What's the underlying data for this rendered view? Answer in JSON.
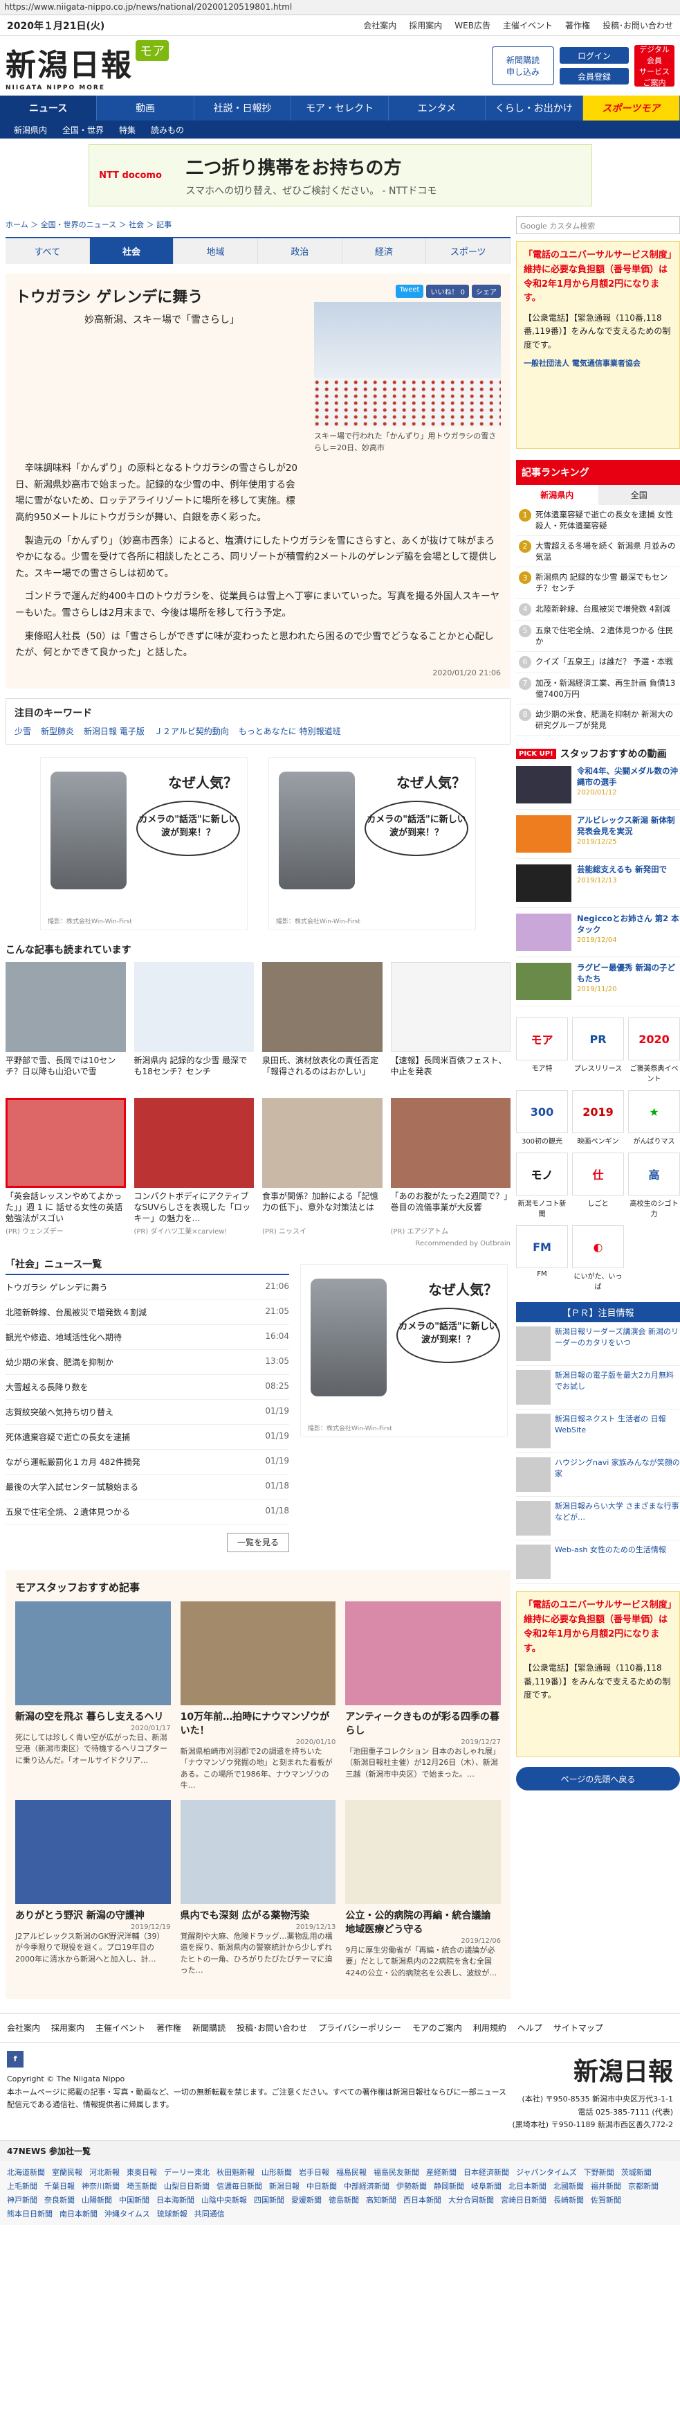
{
  "browser": {
    "url": "https://www.niigata-nippo.co.jp/news/national/20200120519801.html"
  },
  "topbar": {
    "date": "2020年１月21日(火)",
    "links": [
      "会社案内",
      "採用案内",
      "WEB広告",
      "主催イベント",
      "著作権",
      "投稿･お問い合わせ"
    ]
  },
  "header": {
    "logo": "新潟日報",
    "logo_sub": "NIIGATA NIPPO MORE",
    "logo_moa": "モア",
    "register": "新聞購読\n申し込み",
    "login": "ログイン",
    "member": "会員登録",
    "digital": "デジタル\n会員\nサービス\nご案内"
  },
  "gnav": [
    "ニュース",
    "動画",
    "社説・日報抄",
    "モア・セレクト",
    "エンタメ",
    "くらし・お出かけ",
    "スポーツモア"
  ],
  "subnav": [
    "新潟県内",
    "全国・世界",
    "特集",
    "読みもの"
  ],
  "banner": {
    "title": "二つ折り携帯をお持ちの方",
    "text": "スマホへの切り替え、ぜひご検討ください。 - NTTドコモ",
    "brand": "NTT docomo"
  },
  "breadcrumb": "ホーム ＞ 全国・世界のニュース ＞ 社会 ＞ 記事",
  "tabs": [
    "すべて",
    "社会",
    "地域",
    "政治",
    "経済",
    "スポーツ"
  ],
  "article": {
    "title": "トウガラシ ゲレンデに舞う",
    "subtitle": "妙高新潟、スキー場で「雪さらし」",
    "share": [
      "Tweet",
      "いいね！ 0",
      "シェア"
    ],
    "caption": "スキー場で行われた「かんずり」用トウガラシの雪さらし＝20日、妙高市",
    "paragraphs": [
      "辛味調味料「かんずり」の原料となるトウガラシの雪さらしが20日、新潟県妙高市で始まった。記録的な少雪の中、例年使用する会場に雪がないため、ロッテアライリゾートに場所を移して実施。標高約950メートルにトウガラシが舞い、白銀を赤く彩った。",
      "製造元の「かんずり」（妙高市西条）によると、塩漬けにしたトウガラシを雪にさらすと、あくが抜けて味がまろやかになる。少雪を受けて各所に相談したところ、同リゾートが積雪約2メートルのゲレンデ脇を会場として提供した。スキー場での雪さらしは初めて。",
      "ゴンドラで運んだ約400キロのトウガラシを、従業員らは雪上へ丁寧にまいていった。写真を撮る外国人スキーヤーもいた。雪さらしは2月末まで、今後は場所を移して行う予定。",
      "東條昭人社長（50）は「雪さらしができずに味が変わったと思われたら困るので少雪でどうなることかと心配したが、何とかできて良かった」と話した。"
    ],
    "date": "2020/01/20 21:06"
  },
  "keywords": {
    "title": "注目のキーワード",
    "items": [
      "少雪",
      "新型肺炎",
      "新潟日報 電子版",
      "Ｊ２アルビ契約動向",
      "もっとあなたに 特別報道班"
    ]
  },
  "ad_box": {
    "q": "なぜ人気？",
    "bubble": "カメラの\"話活\"に新しい波が到来！？",
    "note": "撮影：株式会社Win-Win-First"
  },
  "recommend": {
    "title": "こんな記事も読まれています",
    "items": [
      {
        "t": "平野部で雪、長岡では10センチ？日以降も山沿いで雪",
        "pr": ""
      },
      {
        "t": "新潟県内 記録的な少雪 最深でも18センチ？センチ",
        "pr": ""
      },
      {
        "t": "泉田氏、演材放表化の責任否定「報得されるのはおかしい」",
        "pr": ""
      },
      {
        "t": "【速報】長岡米百俵フェスト、中止を発表",
        "pr": ""
      },
      {
        "t": "「英会話レッスンやめてよかった」」週 1 に 話せる女性の英語勉強法がスゴい",
        "pr": "(PR) ウェンズデー"
      },
      {
        "t": "コンパクトボディにアクティブなSUVらしさを表現した「ロッキー」の魅力を…",
        "pr": "(PR) ダイハツ工業×carview!"
      },
      {
        "t": "食事が関係？加齢による「記憶力の低下」、意外な対策法とは",
        "pr": "(PR) ニッスイ"
      },
      {
        "t": "「あのお腹がたった2週間で？」巻目の流儀事業が大反響",
        "pr": "(PR) エアジアトム"
      }
    ],
    "outbrain": "Recommended by Outbrain"
  },
  "news_list": {
    "title": "「社会」ニュース一覧",
    "rows": [
      {
        "t": "トウガラシ ゲレンデに舞う",
        "tm": "21:06"
      },
      {
        "t": "北陸新幹線、台風被災で増発数４割減",
        "tm": "21:05"
      },
      {
        "t": "観光や修造、地域活性化へ期待",
        "tm": "16:04"
      },
      {
        "t": "幼少期の米食、肥満を抑制か",
        "tm": "13:05"
      },
      {
        "t": "大雪越える長降り数を",
        "tm": "08:25"
      },
      {
        "t": "志賀紋突破へ気持ち切り替え",
        "tm": "01/19"
      },
      {
        "t": "死体遺棄容疑で逝亡の長女を逮捕",
        "tm": "01/19"
      },
      {
        "t": "ながら運転厳罰化１カ月 482件摘発",
        "tm": "01/19"
      },
      {
        "t": "最後の大学入試センター試験始まる",
        "tm": "01/18"
      },
      {
        "t": "五泉で住宅全焼、２遺体見つかる",
        "tm": "01/18"
      }
    ],
    "more": "一覧を見る"
  },
  "moa": {
    "title": "モアスタッフおすすめ記事",
    "items": [
      {
        "t": "新潟の空を飛ぶ 暮らし支えるヘリ",
        "d": "2020/01/17",
        "x": "死にしては珍しく青い空が広がった日、新潟空港（新潟市東区）で待機するヘリコプターに乗り込んだ。「オールサイドクリア…"
      },
      {
        "t": "10万年前…拍時にナウマンゾウがいた！",
        "d": "2020/01/10",
        "x": "新潟県柏崎市刈羽郡で2の調遣を持ちいた「ナウマンゾウ発掘の地」と刻まれた看板がある。この場所で1986年、ナウマンゾウの牛…"
      },
      {
        "t": "アンティークきものが彩る四季の暮らし",
        "d": "2019/12/27",
        "x": "「池田重子コレクション 日本のおしゃれ展」（新潟日報社主催）が12月26日（木）、新潟三越（新潟市中央区）で始まった。…"
      },
      {
        "t": "ありがとう野沢 新潟の守護神",
        "d": "2019/12/19",
        "x": "J2アルビレックス新潟のGK野沢洋輔（39）が今季限りで現役を退く。プロ19年目の2000年に清水から新潟へと加入し、計…"
      },
      {
        "t": "県内でも深刻 広がる薬物汚染",
        "d": "2019/12/13",
        "x": "覚醒剤や大麻、危険ドラッグ…薬物乱用の構造を探り、新潟県内の警察統計から少しずれたヒトの一角、ひろがりたびたびテーマに迫った…"
      },
      {
        "t": "公立・公的病院の再編・統合議論 地域医療どう守る",
        "d": "2019/12/06",
        "x": "9月に厚生労働省が「再編・統合の議論が必要」だとして新潟県内の22病院を含む全国424の公立・公的病院名を公表し、波紋が…"
      }
    ]
  },
  "side": {
    "search": "Google カスタム検索",
    "ad": {
      "l1": "「電話のユニバーサルサービス制度」",
      "l2": "維持に必要な負担額（番号単価）は",
      "l3": "令和2年1月から月額2円になります。",
      "l4": "【公衆電話】【緊急通報（110番,118番,119番）】をみんなで支えるための制度です。",
      "l5": "一般社団法人 電気通信事業者協会"
    },
    "rank": {
      "title": "記事ランキング",
      "tabs": [
        "新潟県内",
        "全国"
      ],
      "items": [
        "死体遺棄容疑で逝亡の長女を逮捕 女性殺人・死体遺棄容疑",
        "大雪超える冬場を続く 新潟県 月並みの気温",
        "新潟県内 記録的な少雪 最深でもセンチ？センチ",
        "北陸新幹線、台風被災で増発数 4割減",
        "五泉で住宅全焼、２遺体見つかる 住民か",
        "クイズ「五泉王」は誰だ？ 予選・本戦",
        "加茂・新潟経済工業、再生計画 負債13億7400万円",
        "幼少期の米食、肥満を抑制か 新潟大の研究グループが発見"
      ]
    },
    "pick": {
      "badge": "PICK UP!",
      "title": "スタッフおすすめの動画",
      "items": [
        {
          "t": "令和4年、尖闘メダル数の沖縄市の選手",
          "d": "2020/01/12"
        },
        {
          "t": "アルビレックス新潟 新体制発表会見を実況",
          "d": "2019/12/25"
        },
        {
          "t": "芸能総支えるも 新発田で",
          "d": "2019/12/13"
        },
        {
          "t": "Negiccoとお姉さん 第2 本タック",
          "d": "2019/12/04"
        },
        {
          "t": "ラグビー最優秀 新潟の子どもたち",
          "d": "2019/11/20"
        }
      ]
    },
    "icons": [
      "モア特",
      "プレスリリース",
      "ご褒美祭典イベント",
      "300初の観光",
      "映画ペンギン",
      "がんばりマス",
      "新潟モノコト新聞",
      "しごと",
      "高校生のシゴト力",
      "FM",
      "にいがた、いっぱ",
      ""
    ],
    "pr": {
      "title": "【ＰＲ】注目情報",
      "items": [
        "新潟日報リーダーズ講演会 新潟のリーダーのカタリをいつ",
        "新潟日報の電子版を最大2カ月無料でお試し",
        "新潟日報ネクスト 生活者の 日報WebSite",
        "ハウジングnavi 家族みんなが笑顔の家",
        "新潟日報みらい大学 さまざまな行事などが…",
        "Web-ash 女性のための生活情報"
      ]
    },
    "back_top": "ページの先頭へ戻る"
  },
  "footer": {
    "links": [
      "会社案内",
      "採用案内",
      "主催イベント",
      "著作権",
      "新聞購読",
      "投稿･お問い合わせ",
      "プライバシーポリシー",
      "モアのご案内",
      "利用規約",
      "ヘルプ",
      "サイトマップ"
    ],
    "copyright": "Copyright © The Niigata Nippo",
    "notice": "本ホームページに掲載の記事・写真・動画など、一切の無断転載を禁じます。ご注意ください。すべての著作権は新潟日報社ならびに一部ニュース配信元である通信社、情報提供者に帰属します。",
    "logo": "新潟日報",
    "addr1": "(本社) 〒950-8535 新潟市中央区万代3-1-1",
    "addr2": "電話 025-385-7111 (代表)",
    "addr3": "(黒埼本社) 〒950-1189 新潟市西区善久772-2",
    "net47": "47NEWS 参加社一覧",
    "papers": [
      "北海道新聞",
      "室蘭民報",
      "河北新報",
      "東奥日報",
      "デーリー東北",
      "秋田魁新報",
      "山形新聞",
      "岩手日報",
      "福島民報",
      "福島民友新聞",
      "産経新聞",
      "日本経済新聞",
      "ジャパンタイムズ",
      "下野新聞",
      "茨城新聞",
      "上毛新聞",
      "千葉日報",
      "神奈川新聞",
      "埼玉新聞",
      "山梨日日新聞",
      "信濃毎日新聞",
      "新潟日報",
      "中日新聞",
      "中部経済新聞",
      "伊勢新聞",
      "静岡新聞",
      "岐阜新聞",
      "北日本新聞",
      "北國新聞",
      "福井新聞",
      "京都新聞",
      "神戸新聞",
      "奈良新聞",
      "山陽新聞",
      "中国新聞",
      "日本海新聞",
      "山陰中央新報",
      "四国新聞",
      "愛媛新聞",
      "徳島新聞",
      "高知新聞",
      "西日本新聞",
      "大分合同新聞",
      "宮崎日日新聞",
      "長崎新聞",
      "佐賀新聞",
      "熊本日日新聞",
      "南日本新聞",
      "沖縄タイムス",
      "琉球新報",
      "共同通信"
    ]
  }
}
